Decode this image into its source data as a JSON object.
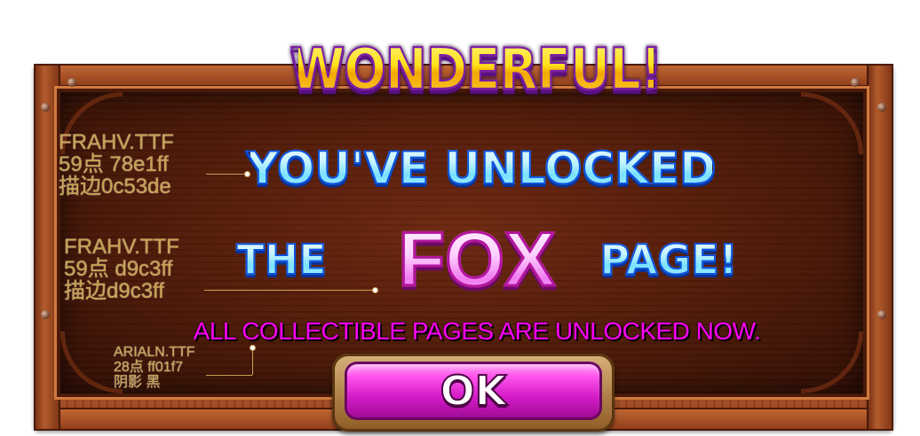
{
  "dialog": {
    "title": "WONDERFUL!",
    "line1": "YOU'VE UNLOCKED",
    "line2_prefix": "THE",
    "line2_highlight": "FOX",
    "line2_suffix": "PAGE!",
    "subtext": "ALL COLLECTIBLE PAGES ARE UNLOCKED NOW.",
    "ok_label": "OK"
  },
  "annotations": [
    {
      "font": "FRAHV.TTF",
      "size_color": "59点  78e1ff",
      "stroke": "描边0c53de"
    },
    {
      "font": "FRAHV.TTF",
      "size_color": "59点  d9c3ff",
      "stroke": "描边d9c3ff"
    },
    {
      "font": "ARIALN.TTF",
      "size_color": "28点  ff01f7",
      "stroke": "阴影 黑"
    }
  ],
  "colors": {
    "line1_fill": "#78e1ff",
    "line1_stroke": "#0c53de",
    "line2_fill": "#d9c3ff",
    "subtext_fill": "#ff01f7",
    "subtext_shadow": "#000000",
    "title_fill": "#ffe11a",
    "ok_button": "#d41bc8",
    "wood": "#8f3f1c"
  }
}
